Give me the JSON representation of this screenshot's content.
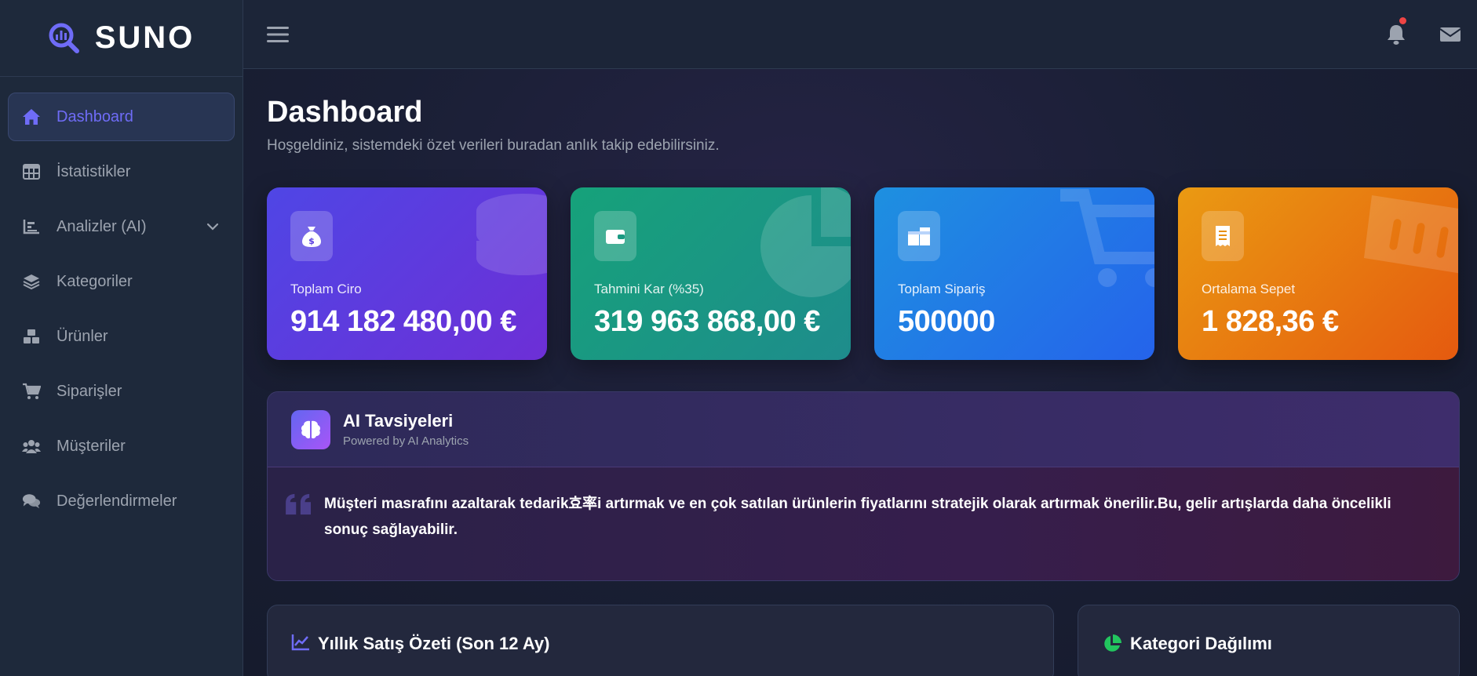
{
  "brand": {
    "name": "SUNO"
  },
  "sidebar": {
    "items": [
      {
        "label": "Dashboard",
        "icon": "home-icon",
        "active": true
      },
      {
        "label": "İstatistikler",
        "icon": "table-icon"
      },
      {
        "label": "Analizler (AI)",
        "icon": "chart-icon",
        "expandable": true
      },
      {
        "label": "Kategoriler",
        "icon": "layers-icon"
      },
      {
        "label": "Ürünler",
        "icon": "boxes-icon"
      },
      {
        "label": "Siparişler",
        "icon": "cart-icon"
      },
      {
        "label": "Müşteriler",
        "icon": "users-icon"
      },
      {
        "label": "Değerlendirmeler",
        "icon": "comments-icon"
      }
    ]
  },
  "header": {
    "title": "Dashboard",
    "subtitle": "Hoşgeldiniz, sistemdeki özet verileri buradan anlık takip edebilirsiniz."
  },
  "stats": [
    {
      "label": "Toplam Ciro",
      "value": "914 182 480,00 €",
      "icon": "money-bag-icon"
    },
    {
      "label": "Tahmini Kar (%35)",
      "value": "319 963 868,00 €",
      "icon": "wallet-icon"
    },
    {
      "label": "Toplam Sipariş",
      "value": "500000",
      "icon": "boxes-icon"
    },
    {
      "label": "Ortalama Sepet",
      "value": "1 828,36 €",
      "icon": "receipt-icon"
    }
  ],
  "ai": {
    "title": "AI Tavsiyeleri",
    "subtitle": "Powered by AI Analytics",
    "text": "Müşteri masrafını azaltarak tedarik효率i artırmak ve en çok satılan ürünlerin fiyatlarını stratejik olarak artırmak önerilir.Bu, gelir artışlarda daha öncelikli sonuç sağlayabilir."
  },
  "panels": {
    "sales_title": "Yıllık Satış Özeti (Son 12 Ay)",
    "category_title": "Kategori Dağılımı"
  },
  "colors": {
    "accent": "#6f6cf7",
    "sidebar_bg": "#1e293b",
    "notification": "#ef4444"
  }
}
